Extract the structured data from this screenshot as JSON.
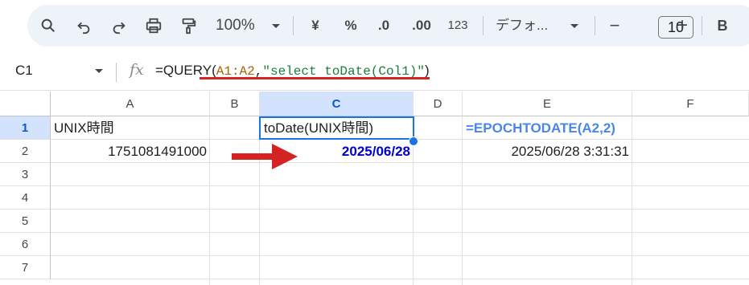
{
  "toolbar": {
    "zoom": "100%",
    "currency_symbol": "¥",
    "percent_symbol": "%",
    "decrease_decimal": ".0",
    "increase_decimal": ".00",
    "number_format": "123",
    "font_name": "デフォ...",
    "font_size": "10",
    "minus": "−",
    "plus": "+",
    "bold": "B"
  },
  "formula_bar": {
    "cell_ref": "C1",
    "fx": "fx",
    "formula_prefix": "=QUERY(",
    "formula_range": "A1:A2",
    "formula_comma": ",",
    "formula_string": "\"select toDate(Col1)\"",
    "formula_suffix": ")"
  },
  "grid": {
    "columns": [
      "A",
      "B",
      "C",
      "D",
      "E",
      "F"
    ],
    "rows": [
      "1",
      "2",
      "3",
      "4",
      "5",
      "6",
      "7"
    ],
    "selected_column": "C",
    "selected_row": "1",
    "cells": {
      "A1": "UNIX時間",
      "A2": "1751081491000",
      "C1": "toDate(UNIX時間)",
      "C2": "2025/06/28",
      "E1": "=EPOCHTODATE(A2,2)",
      "E2": "2025/06/28 3:31:31"
    }
  },
  "colors": {
    "range_orange": "#b06000",
    "string_green": "#188038",
    "accent_blue": "#1a73e8",
    "annotation_blue": "#4a86e8",
    "result_blue": "#0000cc",
    "annotation_red": "#d32323"
  },
  "icons": [
    "search-icon",
    "undo-icon",
    "redo-icon",
    "print-icon",
    "paint-format-icon",
    "chevron-down-icon",
    "fx-icon",
    "right-arrow-icon"
  ]
}
